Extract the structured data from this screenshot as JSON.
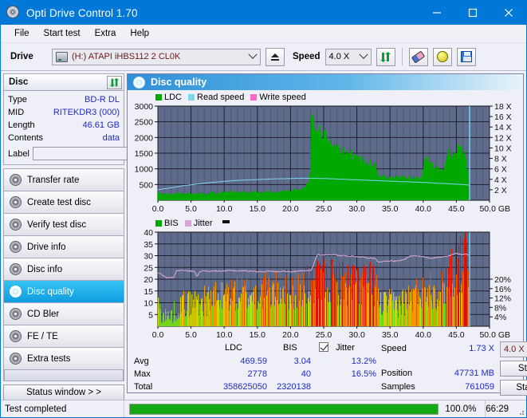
{
  "window": {
    "title": "Opti Drive Control 1.70",
    "app_icon": "disc-icon",
    "minimize": "minimize-icon",
    "maximize": "maximize-icon",
    "close": "close-icon"
  },
  "menu": {
    "items": [
      "File",
      "Start test",
      "Extra",
      "Help"
    ]
  },
  "toolbar": {
    "drive_label": "Drive",
    "drive_value": "(H:)   ATAPI iHBS112  2 CL0K",
    "eject_icon": "eject-icon",
    "speed_label": "Speed",
    "speed_value": "4.0 X",
    "refresh_icon": "refresh-arrows-icon",
    "erase_icon": "eraser-icon",
    "bulb_icon": "bulb-icon",
    "save_icon": "floppy-save-icon"
  },
  "disc_panel": {
    "title": "Disc",
    "refresh_icon": "refresh-arrows-icon",
    "rows": [
      {
        "key": "Type",
        "value": "BD-R DL"
      },
      {
        "key": "MID",
        "value": "RITEKDR3 (000)"
      },
      {
        "key": "Length",
        "value": "46.61 GB"
      },
      {
        "key": "Contents",
        "value": "data"
      }
    ],
    "label_key": "Label",
    "label_value": "",
    "label_placeholder": "",
    "disc_button_icon": "disc-icon"
  },
  "sidebar": {
    "items": [
      {
        "label": "Transfer rate",
        "icon": "disc-transfer-icon",
        "selected": false
      },
      {
        "label": "Create test disc",
        "icon": "disc-create-icon",
        "selected": false
      },
      {
        "label": "Verify test disc",
        "icon": "disc-verify-icon",
        "selected": false
      },
      {
        "label": "Drive info",
        "icon": "disc-drive-icon",
        "selected": false
      },
      {
        "label": "Disc info",
        "icon": "disc-info-icon",
        "selected": false
      },
      {
        "label": "Disc quality",
        "icon": "disc-quality-icon",
        "selected": true
      },
      {
        "label": "CD Bler",
        "icon": "disc-bler-icon",
        "selected": false
      },
      {
        "label": "FE / TE",
        "icon": "disc-fete-icon",
        "selected": false
      },
      {
        "label": "Extra tests",
        "icon": "disc-extra-icon",
        "selected": false
      }
    ],
    "status_window": "Status window > >"
  },
  "main": {
    "title": "Disc quality",
    "icon": "disc-quality-icon"
  },
  "colors": {
    "ldc": "#00a800",
    "bis": "#00a800",
    "read_speed": "#7fd4f0",
    "write_speed": "#ff66cc",
    "jitter": "#d8a8d8",
    "plot_bg": "#5f6b8a",
    "grid": "#2b3042",
    "accent": "#0078d7",
    "value_text": "#2029c8",
    "progress": "#14a814"
  },
  "chart_data": [
    {
      "type": "area",
      "id": "ldc-chart",
      "title": "",
      "legend": [
        {
          "label": "LDC",
          "color": "#00a800"
        },
        {
          "label": "Read speed",
          "color": "#7fd4f0"
        },
        {
          "label": "Write speed",
          "color": "#ff66cc"
        }
      ],
      "xlabel": "GB",
      "xlim": [
        0.0,
        50.0
      ],
      "xticks": [
        "0.0",
        "5.0",
        "10.0",
        "15.0",
        "20.0",
        "25.0",
        "30.0",
        "35.0",
        "40.0",
        "45.0",
        "50.0 GB"
      ],
      "ylabel_left": "LDC",
      "ylim": [
        0,
        3000
      ],
      "yticks": [
        "500",
        "1000",
        "1500",
        "2000",
        "2500",
        "3000"
      ],
      "ylabel_right": "Speed",
      "ylim_right": [
        0,
        18
      ],
      "yticks_right": [
        "2 X",
        "4 X",
        "6 X",
        "8 X",
        "10 X",
        "12 X",
        "14 X",
        "16 X",
        "18 X"
      ],
      "grid": true,
      "series": [
        {
          "name": "LDC",
          "color": "#00a800",
          "x": [
            0.0,
            1.0,
            2.0,
            3.0,
            4.0,
            5.0,
            6.0,
            7.0,
            8.0,
            9.0,
            10.0,
            11.0,
            12.0,
            13.0,
            14.0,
            15.0,
            16.0,
            17.0,
            18.0,
            19.0,
            20.0,
            21.0,
            22.0,
            22.8,
            23.1,
            23.4,
            23.8,
            24.2,
            24.6,
            25.2,
            26.0,
            27.0,
            28.0,
            29.0,
            30.0,
            31.0,
            32.0,
            32.8,
            33.2,
            34.0,
            35.0,
            36.0,
            37.0,
            38.0,
            39.0,
            39.8,
            40.2,
            41.0,
            41.8,
            42.2,
            43.0,
            43.8,
            44.2,
            45.0,
            45.6,
            46.2,
            46.6,
            47.0
          ],
          "values": [
            230,
            200,
            210,
            195,
            215,
            205,
            225,
            215,
            235,
            225,
            255,
            280,
            250,
            265,
            255,
            270,
            260,
            280,
            265,
            290,
            300,
            330,
            420,
            600,
            2780,
            2500,
            2350,
            2280,
            2200,
            2050,
            1900,
            1720,
            1580,
            1460,
            1350,
            1250,
            1170,
            1120,
            800,
            780,
            760,
            740,
            730,
            720,
            710,
            760,
            1280,
            1250,
            1060,
            1000,
            980,
            1620,
            1500,
            1450,
            1900,
            1400,
            1000,
            0
          ]
        },
        {
          "name": "Read speed",
          "color": "#7fd4f0",
          "x": [
            0.0,
            2.0,
            4.0,
            6.0,
            8.0,
            10.0,
            12.0,
            14.0,
            16.0,
            18.0,
            20.0,
            22.0,
            23.0,
            23.2,
            25.0,
            28.0,
            31.0,
            34.0,
            37.0,
            40.0,
            43.0,
            46.0,
            47.0
          ],
          "values": [
            2.0,
            2.4,
            2.8,
            3.1,
            3.4,
            3.6,
            3.8,
            3.9,
            4.0,
            4.1,
            4.15,
            4.2,
            4.2,
            4.2,
            4.15,
            4.0,
            3.85,
            3.7,
            3.55,
            3.4,
            3.2,
            3.0,
            2.9
          ]
        }
      ],
      "marker_line_x": 47.0,
      "marker_color": "#6ee0ff"
    },
    {
      "type": "area",
      "id": "bis-jitter-chart",
      "title": "",
      "legend": [
        {
          "label": "BIS",
          "color": "#00a800"
        },
        {
          "label": "Jitter",
          "color": "#d8a8d8"
        }
      ],
      "xlabel": "GB",
      "xlim": [
        0.0,
        50.0
      ],
      "xticks": [
        "0.0",
        "5.0",
        "10.0",
        "15.0",
        "20.0",
        "25.0",
        "30.0",
        "35.0",
        "40.0",
        "45.0",
        "50.0 GB"
      ],
      "ylabel_left": "BIS",
      "ylim": [
        0,
        40
      ],
      "yticks": [
        "5",
        "10",
        "15",
        "20",
        "25",
        "30",
        "35",
        "40"
      ],
      "ylabel_right": "Jitter",
      "ylim_right": [
        0,
        20
      ],
      "yticks_right": [
        "4%",
        "8%",
        "12%",
        "16%",
        "20%"
      ],
      "grid": true,
      "series": [
        {
          "name": "BIS",
          "color": "#00a800",
          "x": [
            0.0,
            0.5,
            1.0,
            1.5,
            2.0,
            2.5,
            3.0,
            4.0,
            5.0,
            6.0,
            7.0,
            8.0,
            9.0,
            10.0,
            11.0,
            12.0,
            13.0,
            14.0,
            15.0,
            16.0,
            17.0,
            18.0,
            19.0,
            20.0,
            21.0,
            22.0,
            23.0,
            24.0,
            25.0,
            26.0,
            27.0,
            28.0,
            29.0,
            30.0,
            31.0,
            32.0,
            32.9,
            33.2,
            34.0,
            35.0,
            36.0,
            37.0,
            38.0,
            39.0,
            39.8,
            40.5,
            41.2,
            42.0,
            42.6,
            43.2,
            43.8,
            44.4,
            45.0,
            45.6,
            46.2,
            46.8,
            47.0
          ],
          "values": [
            8,
            5,
            4,
            4,
            4,
            6,
            8,
            9,
            9,
            10,
            10,
            11,
            11,
            12,
            13,
            13,
            13,
            13,
            14,
            14,
            14,
            14,
            15,
            15,
            15,
            16,
            16,
            17,
            18,
            18,
            18,
            17,
            17,
            17,
            17,
            17,
            17,
            9,
            9,
            9,
            9,
            10,
            11,
            13,
            16,
            17,
            16,
            14,
            15,
            17,
            21,
            23,
            26,
            24,
            30,
            27,
            0
          ]
        },
        {
          "name": "Jitter",
          "color": "#d8a8d8",
          "x": [
            0.0,
            0.5,
            1.0,
            1.3,
            1.8,
            2.4,
            2.8,
            3.4,
            4.2,
            5.0,
            5.5,
            5.9,
            6.3,
            7.0,
            8.0,
            9.0,
            10.0,
            11.0,
            12.0,
            13.0,
            14.0,
            15.0,
            16.0,
            17.0,
            18.0,
            19.0,
            20.0,
            21.0,
            22.0,
            22.8,
            23.2,
            24.0,
            25.0,
            26.0,
            27.0,
            28.0,
            29.0,
            30.0,
            31.0,
            32.0,
            32.8,
            33.2,
            34.0,
            35.0,
            36.0,
            37.0,
            38.0,
            39.0,
            39.8,
            40.4,
            41.0,
            42.0,
            43.0,
            44.0,
            45.0,
            45.8,
            46.4,
            47.0
          ],
          "values": [
            22.6,
            22.2,
            21.0,
            20.6,
            20.7,
            20.8,
            23.5,
            23.8,
            23.6,
            23.5,
            23.3,
            21.2,
            23.4,
            23.5,
            23.4,
            23.5,
            23.4,
            23.8,
            23.5,
            23.6,
            23.5,
            23.2,
            23.3,
            23.4,
            23.2,
            23.4,
            23.2,
            23.4,
            23.5,
            23.6,
            24.0,
            30.4,
            30.2,
            30.5,
            30.2,
            30.0,
            29.8,
            29.6,
            29.4,
            29.0,
            28.8,
            27.4,
            27.6,
            27.8,
            27.6,
            28.2,
            29.8,
            30.0,
            29.6,
            29.4,
            29.0,
            29.2,
            29.4,
            30.0,
            31.0,
            30.4,
            30.8,
            30.0
          ]
        }
      ],
      "marker_line_x": 47.0,
      "marker_color": "#6ee0ff"
    }
  ],
  "stats": {
    "col_ldc": "LDC",
    "col_bis": "BIS",
    "jitter_label": "Jitter",
    "jitter_checked": true,
    "rows": [
      {
        "key": "Avg",
        "ldc": "469.59",
        "bis": "3.04",
        "jitter": "13.2%"
      },
      {
        "key": "Max",
        "ldc": "2778",
        "bis": "40",
        "jitter": "16.5%"
      },
      {
        "key": "Total",
        "ldc": "358625050",
        "bis": "2320138",
        "jitter": ""
      }
    ],
    "speed_key": "Speed",
    "speed_value": "1.73 X",
    "position_key": "Position",
    "position_value": "47731 MB",
    "samples_key": "Samples",
    "samples_value": "761059",
    "speed_select": "4.0 X",
    "start_full": "Start full",
    "start_part": "Start part"
  },
  "statusbar": {
    "message": "Test completed",
    "progress_percent": "100.0%",
    "progress_value": 100,
    "elapsed": "66:29"
  }
}
